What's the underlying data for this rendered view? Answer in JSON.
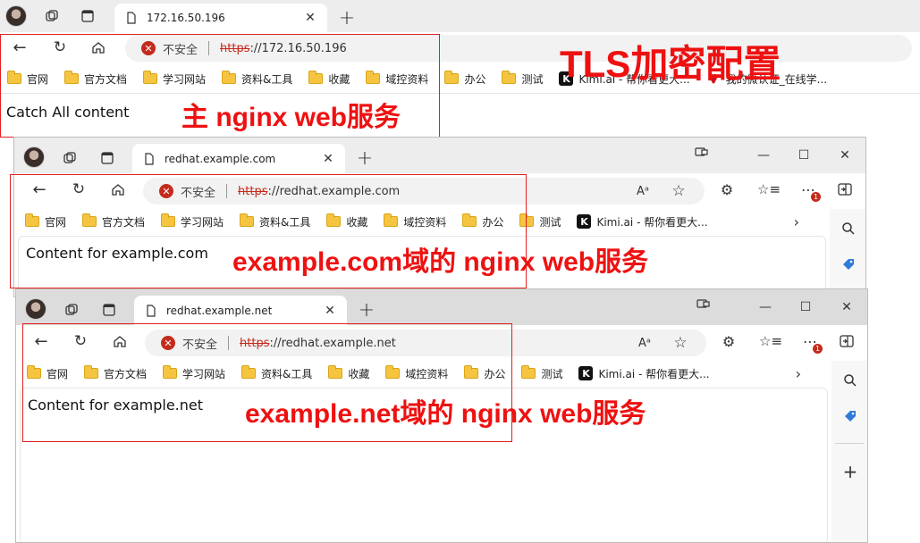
{
  "annotation_title": "TLS加密配置",
  "browser1": {
    "tab_title": "172.16.50.196",
    "insecure_label": "不安全",
    "url_scheme": "https",
    "url_rest": "://172.16.50.196",
    "bookmarks": [
      "官网",
      "官方文档",
      "学习网站",
      "资料&工具",
      "收藏",
      "域控资料",
      "办公",
      "测试",
      "Kimi.ai - 帮你看更大...",
      "我的微认证_在线学..."
    ],
    "content": "Catch All content",
    "annotation": "主 nginx web服务"
  },
  "browser2": {
    "tab_title": "redhat.example.com",
    "insecure_label": "不安全",
    "url_scheme": "https",
    "url_rest": "://redhat.example.com",
    "bookmarks": [
      "官网",
      "官方文档",
      "学习网站",
      "资料&工具",
      "收藏",
      "域控资料",
      "办公",
      "测试",
      "Kimi.ai - 帮你看更大..."
    ],
    "content": "Content for example.com",
    "annotation": "example.com域的 nginx web服务",
    "notification_badge": "1"
  },
  "browser3": {
    "tab_title": "redhat.example.net",
    "insecure_label": "不安全",
    "url_scheme": "https",
    "url_rest": "://redhat.example.net",
    "bookmarks": [
      "官网",
      "官方文档",
      "学习网站",
      "资料&工具",
      "收藏",
      "域控资料",
      "办公",
      "测试",
      "Kimi.ai - 帮你看更大..."
    ],
    "content": "Content for example.net",
    "annotation": "example.net域的 nginx web服务",
    "notification_badge": "1"
  },
  "colors": {
    "annotation_red": "#ee1111",
    "warning_red": "#c42b1c",
    "folder_yellow": "#f5c542"
  }
}
